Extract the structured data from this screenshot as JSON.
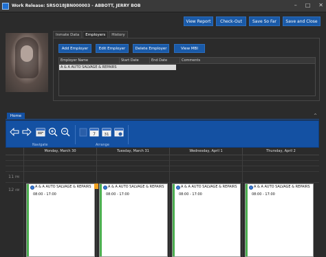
{
  "window": {
    "title": "Work Release: SRSO18JBN000003 - ABBOTT, JERRY BOB",
    "minimize_glyph": "–",
    "maximize_glyph": "□",
    "close_glyph": "✕"
  },
  "toolbar": {
    "view_report": "View Report",
    "check_out": "Check-Out",
    "save_so_far": "Save So Far",
    "save_and_close": "Save and Close"
  },
  "tabs": [
    "Inmate Data",
    "Employers",
    "History"
  ],
  "active_tab": "Employers",
  "employers": {
    "buttons": {
      "add": "Add Employer",
      "edit": "Edit Employer",
      "delete": "Delete Employer",
      "view_mbi": "View MBI"
    },
    "columns": [
      "Employer Name",
      "Start Date",
      "End Date",
      "Comments"
    ],
    "rows": [
      {
        "name": "A & A AUTO SALVAGE & REPAIRS",
        "start": "",
        "end": "",
        "comments": ""
      }
    ]
  },
  "ribbon": {
    "tab": "Home",
    "collapse_glyph": "^",
    "groups": {
      "navigate": "Navigate",
      "arrange": "Arrange"
    },
    "day_icon_num": "7",
    "month_icon_num": "31"
  },
  "calendar": {
    "days": [
      {
        "label": "Monday, March 30"
      },
      {
        "label": "Tuesday, March 31"
      },
      {
        "label": "Wednesday, April 1"
      },
      {
        "label": "Thursday, April 2"
      }
    ],
    "hours": [
      "",
      "",
      "",
      "11 PM",
      "",
      "",
      "",
      ""
    ],
    "visible_hour_labels": {
      "h11": "11",
      "h11_pm": "PM",
      "h12": "12",
      "h12_am": "AM"
    },
    "appointments": [
      {
        "title": "A & A AUTO SALVAGE & REPAIRS",
        "time": "08:00 - 17:00"
      },
      {
        "title": "A & A AUTO SALVAGE & REPAIRS",
        "time": "08:00 - 17:00"
      },
      {
        "title": "A & A AUTO SALVAGE & REPAIRS",
        "time": "08:00 - 17:00"
      },
      {
        "title": "A & A AUTO SALVAGE & REPAIRS",
        "time": "08:00 - 17:00"
      }
    ]
  },
  "colors": {
    "accent": "#1451a3",
    "button": "#1a5aa8",
    "appointment_bar": "#4caf50",
    "status_orange": "#f0a020"
  }
}
